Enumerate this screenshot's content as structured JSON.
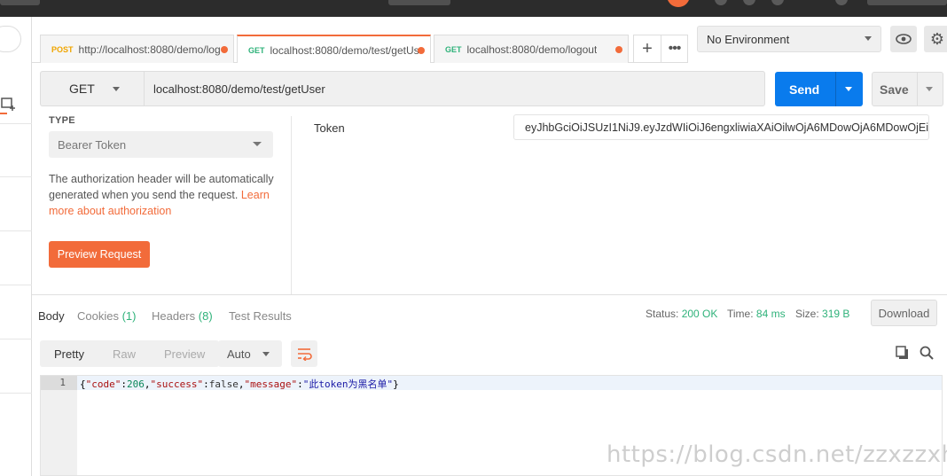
{
  "tabs": [
    {
      "method": "POST",
      "url": "http://localhost:8080/demo/log"
    },
    {
      "method": "GET",
      "url": "localhost:8080/demo/test/getUs"
    },
    {
      "method": "GET",
      "url": "localhost:8080/demo/logout"
    }
  ],
  "tab_add_label": "+",
  "tab_more_label": "•••",
  "environment": {
    "selected": "No Environment"
  },
  "request": {
    "method": "GET",
    "url": "localhost:8080/demo/test/getUser",
    "send_label": "Send",
    "save_label": "Save"
  },
  "auth": {
    "type_label": "TYPE",
    "type_value": "Bearer Token",
    "description": "The authorization header will be automatically generated when you send the request.",
    "learn_more": "Learn more about authorization",
    "preview_label": "Preview Request",
    "token_label": "Token",
    "token_value": "eyJhbGciOiJSUzI1NiJ9.eyJzdWIiOiJ6engxliwiaXAiOilwOjA6MDowOjA6MDowOjEi..."
  },
  "response": {
    "tabs": {
      "body": "Body",
      "cookies": "Cookies",
      "cookies_count": "(1)",
      "headers": "Headers",
      "headers_count": "(8)",
      "test_results": "Test Results"
    },
    "status_label": "Status:",
    "status_value": "200 OK",
    "time_label": "Time:",
    "time_value": "84 ms",
    "size_label": "Size:",
    "size_value": "319 B",
    "download_label": "Download",
    "view_modes": [
      "Pretty",
      "Raw",
      "Preview"
    ],
    "active_view": "Pretty",
    "format": "Auto",
    "line_number": "1",
    "body": {
      "open": "{",
      "k1": "\"code\"",
      "v1": "206",
      "k2": "\"success\"",
      "v2": "false",
      "k3": "\"message\"",
      "v3": "\"此token为黑名单\"",
      "close": "}"
    }
  },
  "watermark": "https://blog.csdn.net/zzxzzxhao",
  "colors": {
    "accent": "#f26b3a",
    "send_blue": "#097bed",
    "status_green": "#2fb27a"
  },
  "icons": [
    "new-collection-icon",
    "eye-icon",
    "gear-icon",
    "wrap-lines-icon",
    "copy-icon",
    "search-icon"
  ]
}
